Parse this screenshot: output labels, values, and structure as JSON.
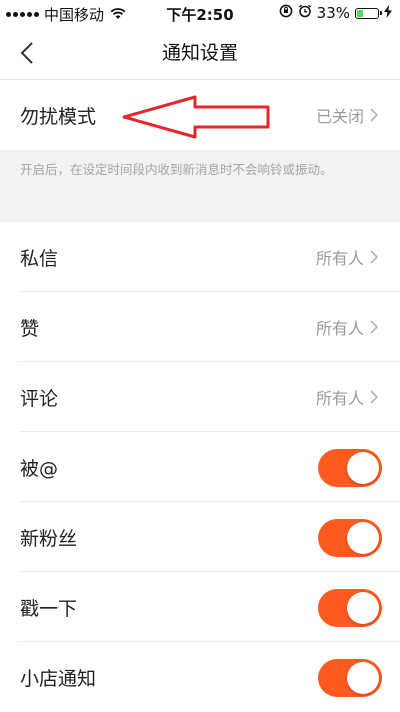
{
  "status_bar": {
    "carrier": "中国移动",
    "time": "下午2:50",
    "battery_percent": "33%",
    "battery_level": 0.33
  },
  "nav": {
    "title": "通知设置"
  },
  "dnd": {
    "label": "勿扰模式",
    "value": "已关闭",
    "hint": "开启后，在设定时间段内收到新消息时不会响铃或振动。"
  },
  "rows": [
    {
      "label": "私信",
      "value": "所有人"
    },
    {
      "label": "赞",
      "value": "所有人"
    },
    {
      "label": "评论",
      "value": "所有人"
    }
  ],
  "toggles": [
    {
      "label": "被@",
      "on": true
    },
    {
      "label": "新粉丝",
      "on": true
    },
    {
      "label": "戳一下",
      "on": true
    },
    {
      "label": "小店通知",
      "on": true
    }
  ],
  "colors": {
    "accent": "#ff5a1f",
    "annotation": "#e8262a"
  }
}
